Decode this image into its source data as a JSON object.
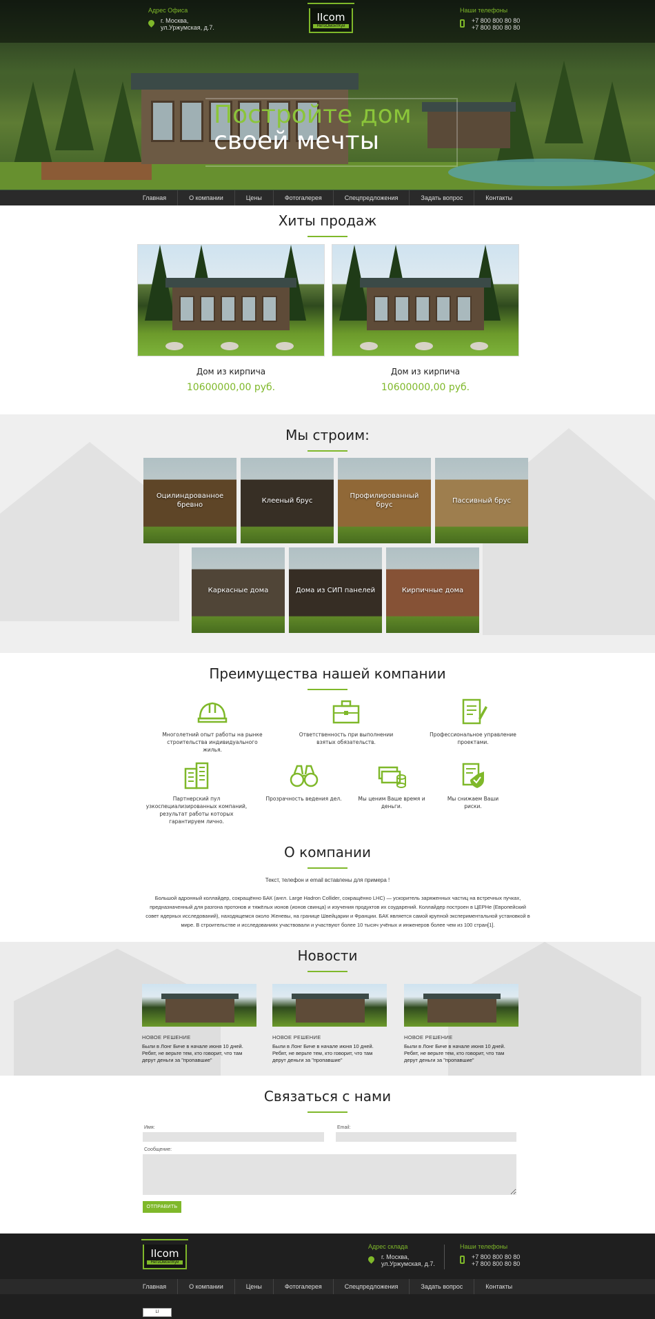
{
  "header": {
    "address_label": "Адрес Офиса",
    "address_line1": "г. Москва,",
    "address_line2": "ул.Уржумская, д.7.",
    "phones_label": "Наши телефоны",
    "phone1": "+7 800 800 80 80",
    "phone2": "+7 800 800 80 80",
    "logo_name": "IIcom",
    "logo_sub": "НетзОмонтКуй"
  },
  "hero": {
    "title_line1": "Постройте дом",
    "title_line2": "своей мечты"
  },
  "nav": [
    "Главная",
    "О компании",
    "Цены",
    "Фотогалерея",
    "Спецпредложения",
    "Задать вопрос",
    "Контакты"
  ],
  "hits": {
    "title": "Хиты продаж",
    "products": [
      {
        "name": "Дом из кирпича",
        "price": "10600000,00 руб."
      },
      {
        "name": "Дом из кирпича",
        "price": "10600000,00 руб."
      }
    ]
  },
  "build": {
    "title": "Мы строим:",
    "tiles": [
      {
        "label": "Оцилиндрованное бревно",
        "color": "#6b4a2a"
      },
      {
        "label": "Клееный брус",
        "color": "#3b2f28"
      },
      {
        "label": "Профилированный брус",
        "color": "#a8743e"
      },
      {
        "label": "Пассивный брус",
        "color": "#b98f5a"
      },
      {
        "label": "Каркасные дома",
        "color": "#5a4a3e"
      },
      {
        "label": "Дома из СИП панелей",
        "color": "#3a2c26"
      },
      {
        "label": "Кирпичные дома",
        "color": "#9c5a3c"
      }
    ]
  },
  "advantages": {
    "title": "Преимущества нашей компании",
    "items": [
      {
        "icon": "hard-hat-icon",
        "text": "Многолетний опыт работы на рынке строительства индивидуального жилья."
      },
      {
        "icon": "briefcase-icon",
        "text": "Ответственность при выполнении взятых обязательств."
      },
      {
        "icon": "document-pen-icon",
        "text": "Профессиональное управление проектами."
      },
      {
        "icon": "buildings-icon",
        "text": "Партнерский пул узкоспециализированных компаний, результат работы которых гарантируем лично."
      },
      {
        "icon": "binoculars-icon",
        "text": "Прозрачность ведения дел."
      },
      {
        "icon": "money-icon",
        "text": "Мы ценим Ваше время и деньги."
      },
      {
        "icon": "shield-document-icon",
        "text": "Мы снижаем Ваши риски."
      }
    ]
  },
  "about": {
    "title": "О компании",
    "lead": "Текст, телефон и email вставлены для примера !",
    "body": "Большой адронный коллайдер, сокращённо БАК (англ. Large Hadron Collider, сокращённо LHC) — ускоритель заряженных частиц на встречных пучках, предназначенный для разгона протонов и тяжёлых ионов (ионов свинца) и изучения продуктов их соударений. Коллайдер построен в ЦЕРНе (Европейский совет ядерных исследований), находящемся около Женевы, на границе Швейцарии и Франции. БАК является самой крупной экспериментальной установкой в мире. В строительстве и исследованиях участвовали и участвуют более 10 тысяч учёных и инженеров более чем из 100 стран[1]."
  },
  "news": {
    "title": "Новости",
    "items": [
      {
        "tag": "НОВОЕ РЕШЕНИЕ",
        "text": "Были в Лонг Биче в начале июня 10 дней. Ребят, не верьте тем, кто говорит, что там дерут деньги за \"пропавшие\""
      },
      {
        "tag": "НОВОЕ РЕШЕНИЕ",
        "text": "Были в Лонг Биче в начале июня 10 дней. Ребят, не верьте тем, кто говорит, что там дерут деньги за \"пропавшие\""
      },
      {
        "tag": "НОВОЕ РЕШЕНИЕ",
        "text": "Были в Лонг Биче в начале июня 10 дней. Ребят, не верьте тем, кто говорит, что там дерут деньги за \"пропавшие\""
      }
    ]
  },
  "contact": {
    "title": "Связаться с нами",
    "name_label": "Имя:",
    "email_label": "Email:",
    "message_label": "Сообщение:",
    "send_label": "ОТПРАВИТЬ"
  },
  "footer": {
    "address_label": "Адрес склада",
    "address_line1": "г. Москва,",
    "address_line2": "ул.Уржумская, д.7.",
    "phones_label": "Наши телефоны",
    "phone1": "+7 800 800 80 80",
    "phone2": "+7 800 800 80 80",
    "counter": "LI"
  },
  "colors": {
    "accent": "#7fb82a",
    "dark": "#2a2a2a"
  }
}
